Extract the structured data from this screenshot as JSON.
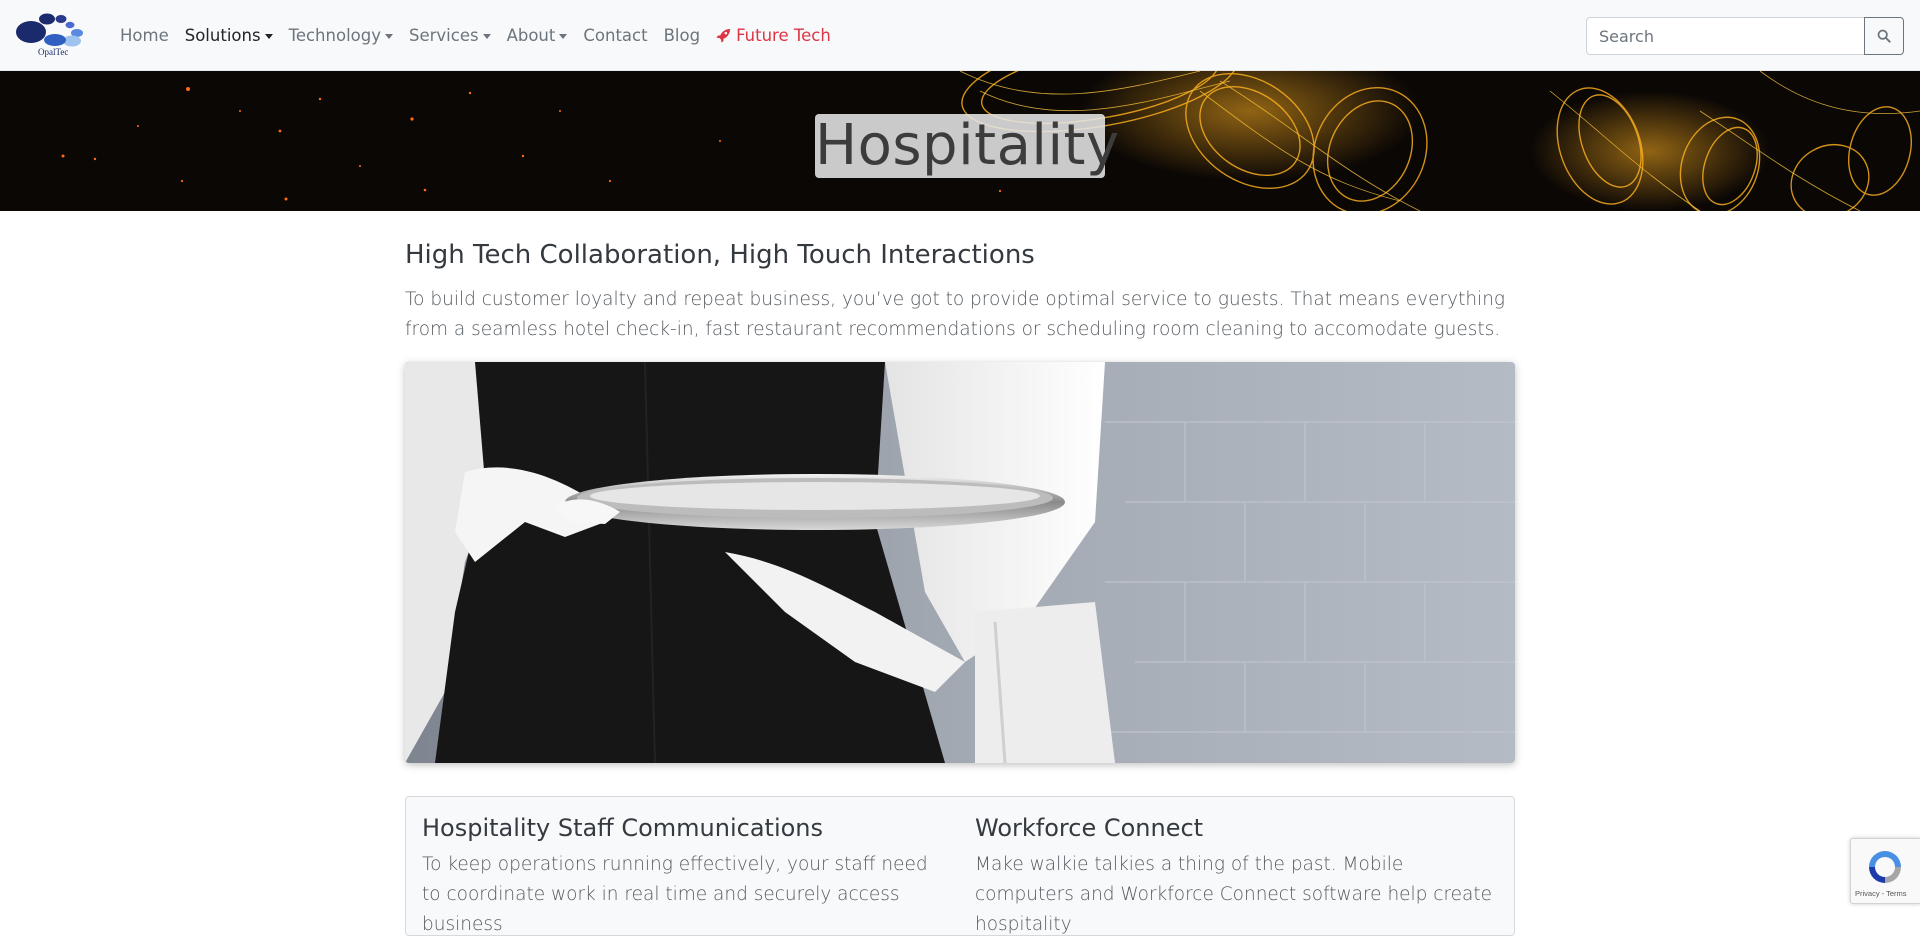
{
  "brand": {
    "logo_text": "OpalTec",
    "logo_color": "#1a2a6c"
  },
  "nav": {
    "items": [
      {
        "label": "Home",
        "dropdown": false
      },
      {
        "label": "Solutions",
        "dropdown": true,
        "active": true
      },
      {
        "label": "Technology",
        "dropdown": true
      },
      {
        "label": "Services",
        "dropdown": true
      },
      {
        "label": "About",
        "dropdown": true
      },
      {
        "label": "Contact",
        "dropdown": false
      },
      {
        "label": "Blog",
        "dropdown": false
      }
    ],
    "future": {
      "label": "Future Tech",
      "icon": "rocket-icon",
      "color": "#dc3545"
    }
  },
  "search": {
    "placeholder": "Search",
    "value": "",
    "button_icon": "search-icon"
  },
  "hero": {
    "title": "Hospitality"
  },
  "main": {
    "heading": "High Tech Collaboration, High Touch Interactions",
    "lead": "To build customer loyalty and repeat business, you’ve got to provide optimal service to guests. That means everything from a seamless hotel check-in, fast restaurant recommendations or scheduling room cleaning to accomodate guests.",
    "image_subject": "waiter in white gloves holding silver tray"
  },
  "features": [
    {
      "title": "Hospitality Staff Communications",
      "text": "To keep operations running effectively, your staff need to coordinate work in real time and securely access business"
    },
    {
      "title": "Workforce Connect",
      "text": "Make walkie talkies a thing of the past. Mobile computers and Workforce Connect software help create hospitality"
    }
  ],
  "recaptcha": {
    "terms": "Privacy - Terms"
  }
}
